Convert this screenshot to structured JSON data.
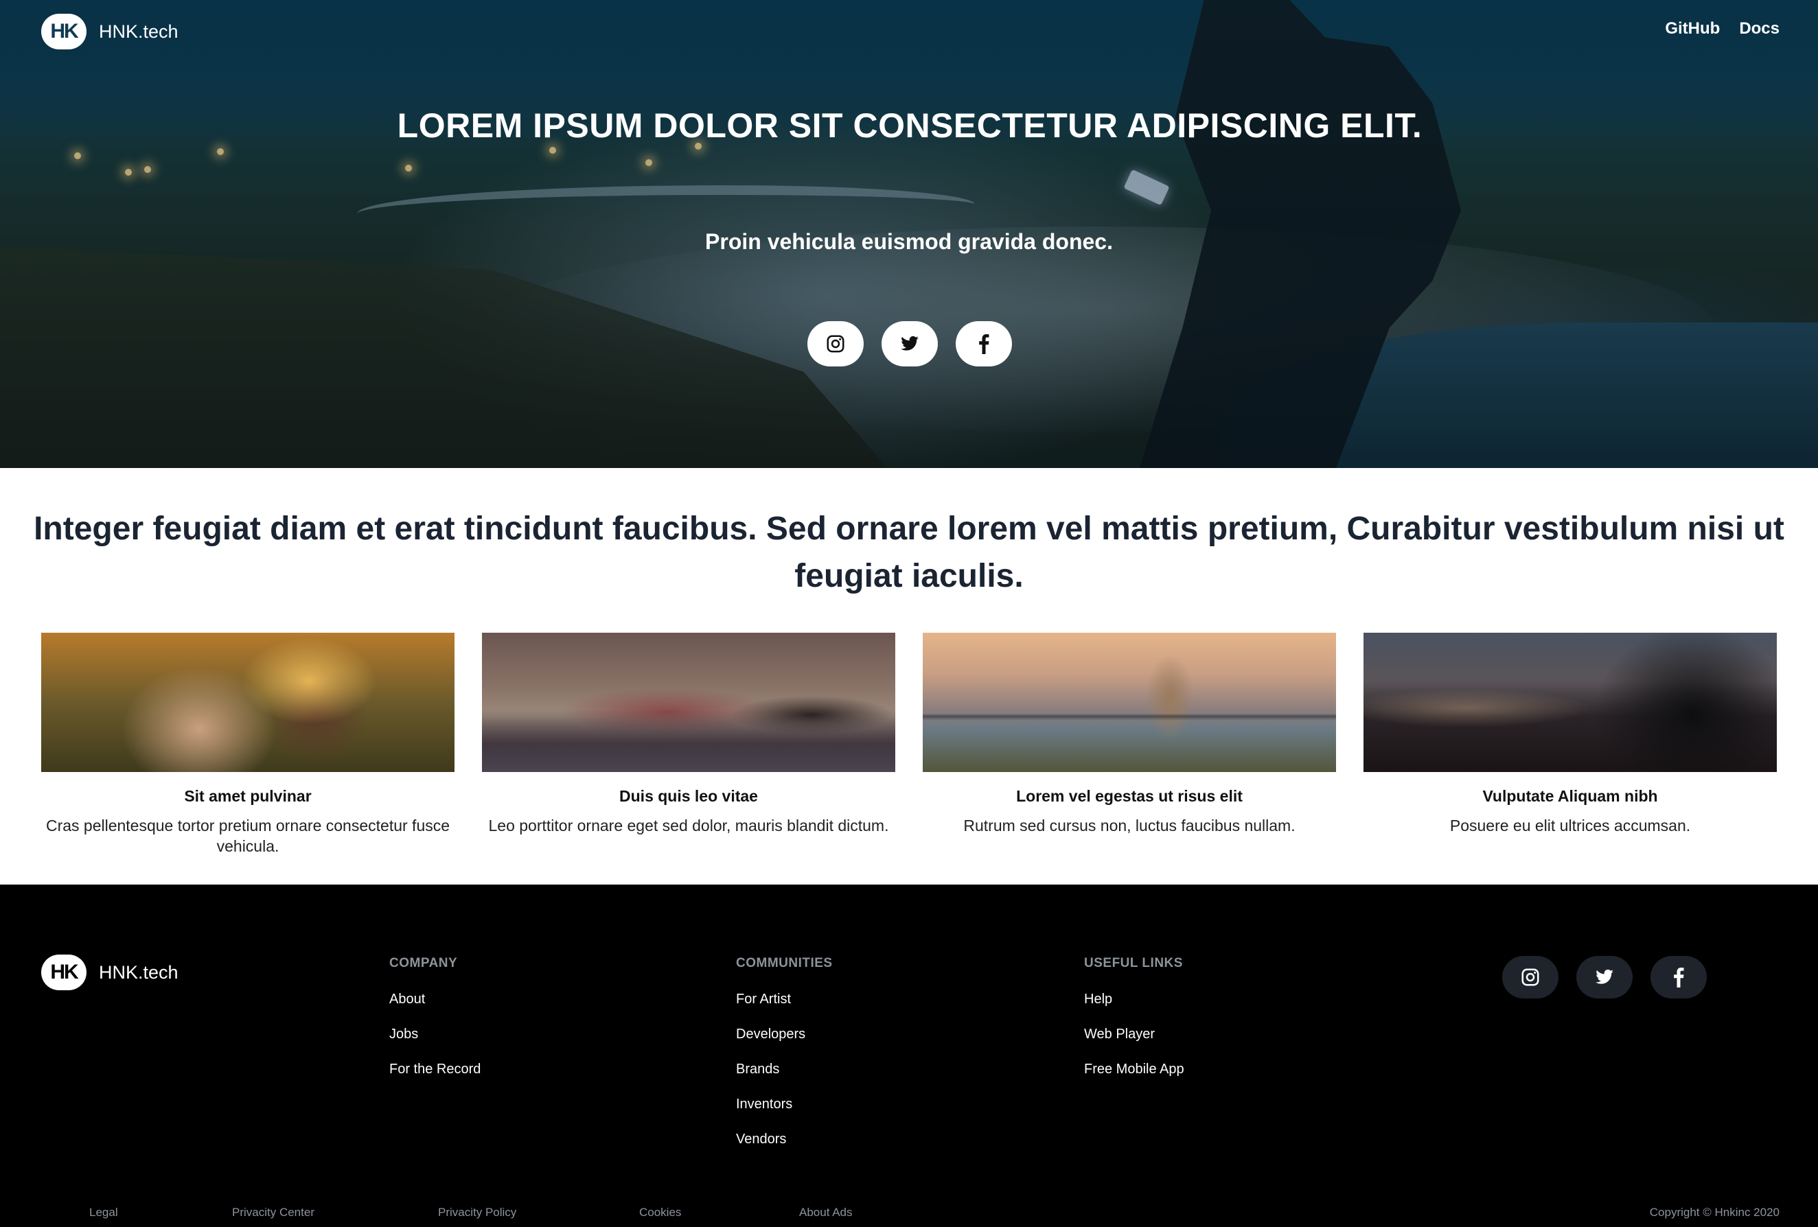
{
  "nav": {
    "brand": "HNK.tech",
    "logo_text": "HK",
    "links": [
      "GitHub",
      "Docs"
    ]
  },
  "hero": {
    "title": "LOREM IPSUM DOLOR SIT CONSECTETUR ADIPISCING ELIT.",
    "subtitle": "Proin vehicula euismod gravida donec.",
    "social": [
      "instagram-icon",
      "twitter-icon",
      "facebook-icon"
    ]
  },
  "intro": {
    "text": "Integer feugiat diam et erat tincidunt faucibus. Sed ornare lorem vel mattis pretium, Curabitur vestibulum nisi ut feugiat iaculis."
  },
  "cards": [
    {
      "title": "Sit amet pulvinar",
      "desc": "Cras pellentesque tortor pretium ornare consectetur fusce vehicula."
    },
    {
      "title": "Duis quis leo vitae",
      "desc": "Leo porttitor ornare eget sed dolor, mauris blandit dictum."
    },
    {
      "title": "Lorem vel egestas ut risus elit",
      "desc": "Rutrum sed cursus non, luctus faucibus nullam."
    },
    {
      "title": "Vulputate Aliquam nibh",
      "desc": "Posuere eu elit ultrices accumsan."
    }
  ],
  "footer": {
    "brand": "HNK.tech",
    "columns": [
      {
        "heading": "COMPANY",
        "links": [
          "About",
          "Jobs",
          "For the Record"
        ]
      },
      {
        "heading": "COMMUNITIES",
        "links": [
          "For Artist",
          "Developers",
          "Brands",
          "Inventors",
          "Vendors"
        ]
      },
      {
        "heading": "USEFUL LINKS",
        "links": [
          "Help",
          "Web Player",
          "Free Mobile App"
        ]
      }
    ],
    "social": [
      "instagram-icon",
      "twitter-icon",
      "facebook-icon"
    ],
    "bottom_links": [
      "Legal",
      "Privacity Center",
      "Privacity Policy",
      "Cookies",
      "About Ads"
    ],
    "copyright": "Copyright © Hnkinc 2020"
  },
  "colors": {
    "hero_bg": "#0e3b52",
    "text_dark": "#1b2433",
    "footer_bg": "#000000",
    "footer_muted": "#8d939c",
    "footer_icon_bg": "#1e232c"
  }
}
